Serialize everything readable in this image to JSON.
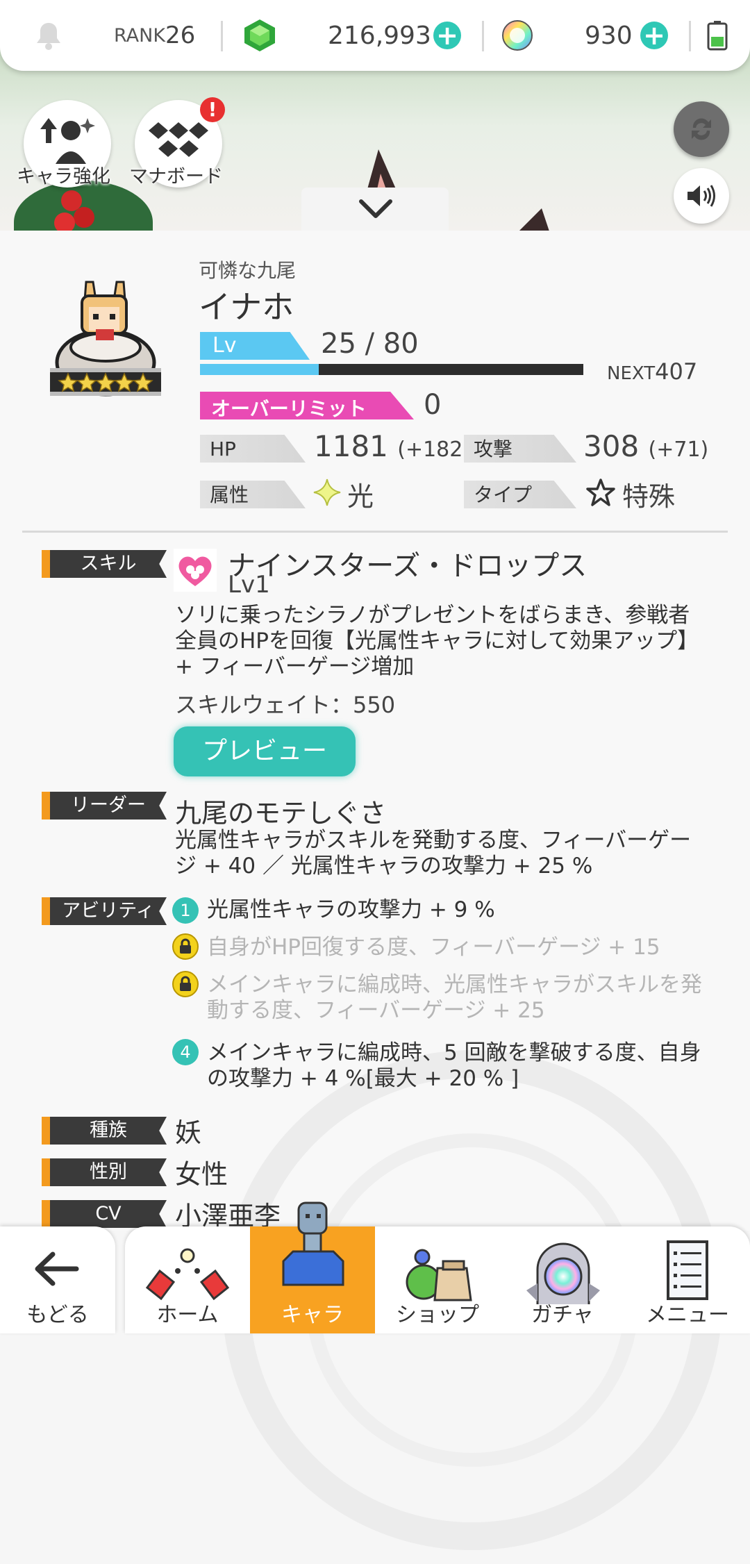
{
  "status_bar": {
    "rank_label": "RANK",
    "rank_value": "26",
    "gems": "216,993",
    "orbs": "930"
  },
  "banner": {
    "enhance_label": "キャラ強化",
    "manaboard_label": "マナボード",
    "manaboard_badge": "!"
  },
  "character": {
    "title": "可憐な九尾",
    "name": "イナホ",
    "lv_label": "Lv",
    "level": "25 / 80",
    "level_progress": 0.31,
    "next_label": "NEXT",
    "next_value": "407",
    "overlimit_label": "オーバーリミット",
    "overlimit_value": "0",
    "hp_label": "HP",
    "hp_value": "1181",
    "hp_bonus": "(+182)",
    "attack_label": "攻撃",
    "attack_value": "308",
    "attack_bonus": "(+71)",
    "attribute_label": "属性",
    "attribute_value": "光",
    "type_label": "タイプ",
    "type_value": "特殊"
  },
  "skill": {
    "tag": "スキル",
    "name": "ナインスターズ・ドロップス",
    "level": "Lv1",
    "description": "ソリに乗ったシラノがプレゼントをばらまき、参戦者全員のHPを回復【光属性キャラに対して効果アップ】 + フィーバーゲージ増加",
    "wait": "スキルウェイト：550",
    "preview_button": "プレビュー"
  },
  "leader": {
    "tag": "リーダー",
    "name": "九尾のモテしぐさ",
    "description": "光属性キャラがスキルを発動する度、フィーバーゲージ + 40 ／ 光属性キャラの攻撃力 + 25 %"
  },
  "ability": {
    "tag": "アビリティ",
    "items": [
      {
        "num": "1",
        "text": "光属性キャラの攻撃力 + 9 %",
        "locked": false
      },
      {
        "num": "",
        "text": "自身がHP回復する度、フィーバーゲージ + 15",
        "locked": true
      },
      {
        "num": "",
        "text": "メインキャラに編成時、光属性キャラがスキルを発動する度、フィーバーゲージ + 25",
        "locked": true
      },
      {
        "num": "4",
        "text": "メインキャラに編成時、5 回敵を撃破する度、自身の攻撃力 + 4 %[最大 + 20 % ]",
        "locked": false
      }
    ]
  },
  "profile": {
    "race_tag": "種族",
    "race": "妖",
    "gender_tag": "性別",
    "gender": "女性",
    "cv_tag": "CV",
    "cv": "小澤亜李"
  },
  "nav": {
    "back": "もどる",
    "home": "ホーム",
    "chara": "キャラ",
    "shop": "ショップ",
    "gacha": "ガチャ",
    "menu": "メニュー"
  },
  "colors": {
    "accent_teal": "#2ec8b5",
    "lv_blue": "#5bc8f2",
    "overlimit_pink": "#e94bb4",
    "tag_orange": "#f39a1e",
    "nav_active": "#f8a221"
  }
}
